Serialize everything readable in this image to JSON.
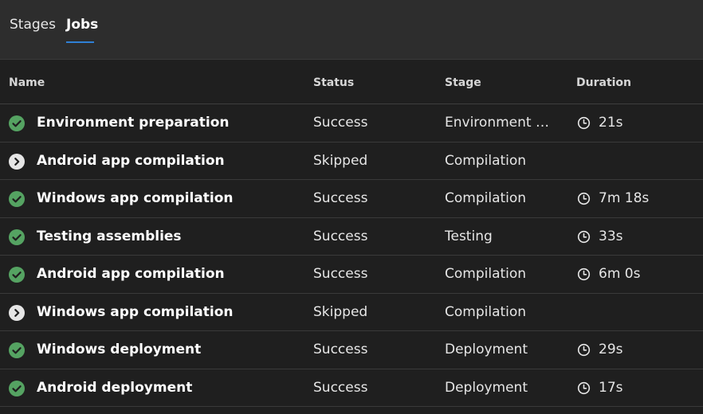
{
  "tabs": [
    {
      "label": "Stages"
    },
    {
      "label": "Jobs"
    }
  ],
  "active_tab": "Jobs",
  "columns": {
    "name": "Name",
    "status": "Status",
    "stage": "Stage",
    "duration": "Duration"
  },
  "colors": {
    "success": "#55a362",
    "skipped": "#e6e6e6",
    "accent": "#2f80d6"
  },
  "rows": [
    {
      "name": "Environment preparation",
      "status": "Success",
      "stage": "Environment pr...",
      "duration": "21s",
      "icon": "check-circle-icon"
    },
    {
      "name": "Android app compilation",
      "status": "Skipped",
      "stage": "Compilation",
      "duration": "",
      "icon": "skip-circle-icon"
    },
    {
      "name": "Windows app compilation",
      "status": "Success",
      "stage": "Compilation",
      "duration": "7m 18s",
      "icon": "check-circle-icon"
    },
    {
      "name": "Testing assemblies",
      "status": "Success",
      "stage": "Testing",
      "duration": "33s",
      "icon": "check-circle-icon"
    },
    {
      "name": "Android app compilation",
      "status": "Success",
      "stage": "Compilation",
      "duration": "6m 0s",
      "icon": "check-circle-icon"
    },
    {
      "name": "Windows app compilation",
      "status": "Skipped",
      "stage": "Compilation",
      "duration": "",
      "icon": "skip-circle-icon"
    },
    {
      "name": "Windows deployment",
      "status": "Success",
      "stage": "Deployment",
      "duration": "29s",
      "icon": "check-circle-icon"
    },
    {
      "name": "Android deployment",
      "status": "Success",
      "stage": "Deployment",
      "duration": "17s",
      "icon": "check-circle-icon"
    }
  ]
}
